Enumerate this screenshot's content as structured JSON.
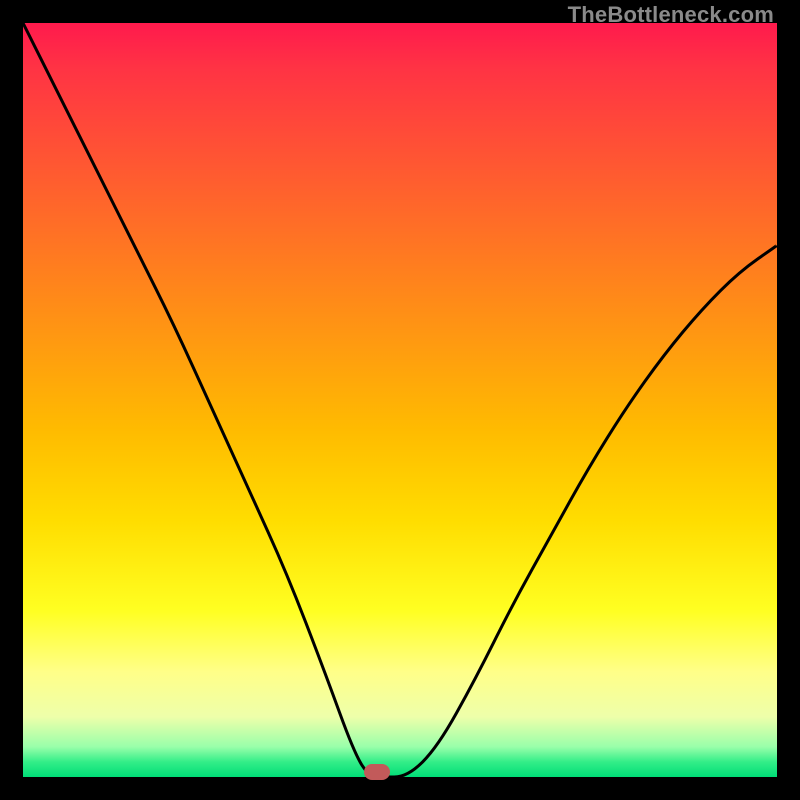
{
  "watermark": "TheBottleneck.com",
  "chart_data": {
    "type": "line",
    "title": "",
    "xlabel": "",
    "ylabel": "",
    "xlim": [
      0,
      1
    ],
    "ylim": [
      0,
      1
    ],
    "series": [
      {
        "name": "curve",
        "x": [
          0.0,
          0.05,
          0.1,
          0.15,
          0.2,
          0.25,
          0.3,
          0.35,
          0.4,
          0.44,
          0.46,
          0.475,
          0.51,
          0.55,
          0.6,
          0.65,
          0.7,
          0.75,
          0.8,
          0.85,
          0.9,
          0.95,
          1.0
        ],
        "y": [
          1.0,
          0.9,
          0.8,
          0.7,
          0.6,
          0.49,
          0.38,
          0.27,
          0.14,
          0.03,
          0.0,
          0.0,
          0.0,
          0.04,
          0.13,
          0.23,
          0.32,
          0.41,
          0.49,
          0.56,
          0.62,
          0.67,
          0.705
        ]
      }
    ],
    "marker": {
      "x": 0.47,
      "y": 0.007,
      "color": "#c25a5a"
    },
    "gradient_colors": {
      "top": "#ff1a4d",
      "mid": "#ffff22",
      "bottom": "#00dd77"
    }
  }
}
